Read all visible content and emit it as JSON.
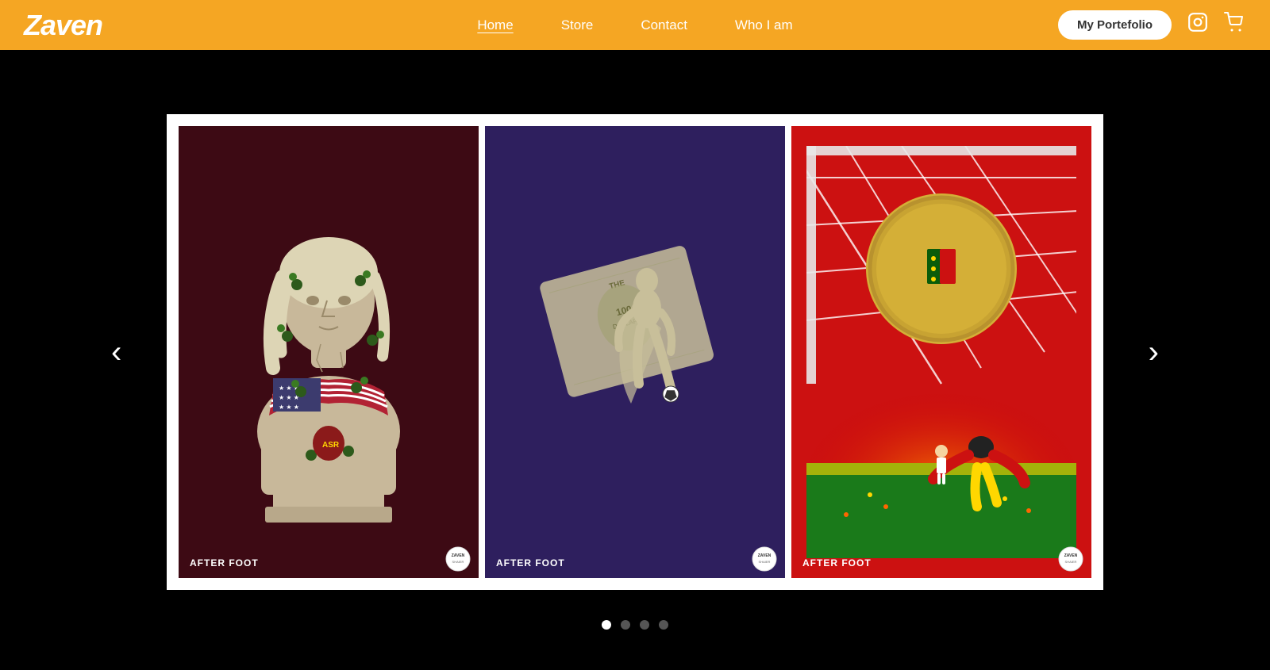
{
  "header": {
    "logo": "Zaven",
    "nav": {
      "items": [
        {
          "label": "Home",
          "active": true,
          "id": "home"
        },
        {
          "label": "Store",
          "active": false,
          "id": "store"
        },
        {
          "label": "Contact",
          "active": false,
          "id": "contact"
        },
        {
          "label": "Who I am",
          "active": false,
          "id": "whoiam"
        }
      ]
    },
    "portfolio_btn": "My Portefolio",
    "instagram_icon": "instagram-icon",
    "cart_icon": "cart-icon"
  },
  "carousel": {
    "prev_label": "‹",
    "next_label": "›",
    "cards": [
      {
        "id": "card-1",
        "label": "AFTER FOOT",
        "bg": "#3D0A14",
        "description": "Roman bust with American flag and ivy vines illustration"
      },
      {
        "id": "card-2",
        "label": "AFTER FOOT",
        "bg": "#3B2A6E",
        "description": "Soccer player with dollar bill illustration on purple background"
      },
      {
        "id": "card-3",
        "label": "AFTER FOOT",
        "bg": "#CC1111",
        "description": "Portugal soccer goal with coin illustration on red background"
      }
    ],
    "dots": [
      {
        "active": true
      },
      {
        "active": false
      },
      {
        "active": false
      },
      {
        "active": false
      }
    ]
  }
}
